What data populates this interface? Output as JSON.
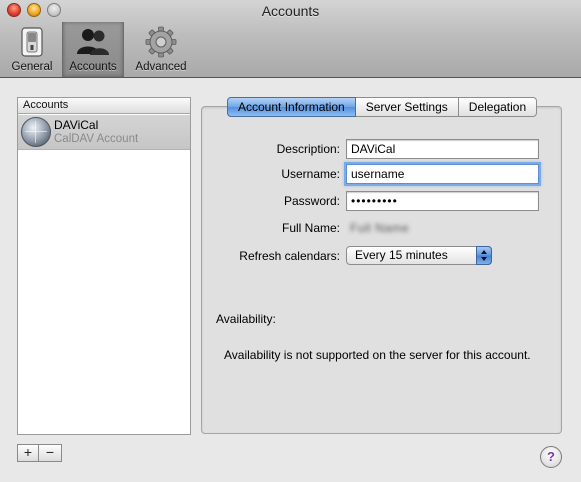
{
  "window": {
    "title": "Accounts"
  },
  "toolbar": {
    "items": [
      {
        "label": "General",
        "icon": "general-switch-icon",
        "selected": false
      },
      {
        "label": "Accounts",
        "icon": "accounts-people-icon",
        "selected": true
      },
      {
        "label": "Advanced",
        "icon": "advanced-gear-icon",
        "selected": false
      }
    ]
  },
  "sidebar": {
    "header": "Accounts",
    "accounts": [
      {
        "name": "DAViCal",
        "type": "CalDAV Account",
        "icon": "globe-icon",
        "selected": true
      }
    ],
    "add_label": "+",
    "remove_label": "−"
  },
  "tabs": [
    {
      "label": "Account Information",
      "active": true
    },
    {
      "label": "Server Settings",
      "active": false
    },
    {
      "label": "Delegation",
      "active": false
    }
  ],
  "form": {
    "description_label": "Description:",
    "description_value": "DAViCal",
    "username_label": "Username:",
    "username_value": "username",
    "password_label": "Password:",
    "password_value": "•••••••••",
    "fullname_label": "Full Name:",
    "fullname_value": "Full Name",
    "refresh_label": "Refresh calendars:",
    "refresh_value": "Every 15 minutes"
  },
  "availability": {
    "title": "Availability:",
    "message": "Availability is not supported on the server for this account."
  },
  "help_label": "?",
  "colors": {
    "selection_blue": "#6fa5e6",
    "focus_ring": "#7ea9e4",
    "help_mark": "#7a3aa8"
  }
}
